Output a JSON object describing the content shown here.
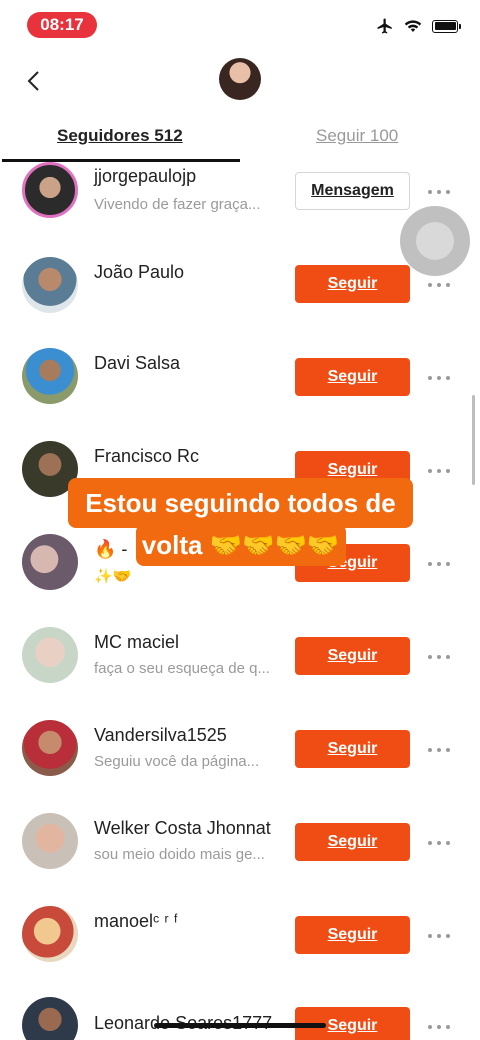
{
  "status_bar": {
    "time": "08:17",
    "airplane_icon": "airplane-icon",
    "wifi_icon": "wifi-icon",
    "battery_icon": "battery-icon"
  },
  "header": {
    "back_icon": "chevron-left-icon"
  },
  "tabs": [
    {
      "label": "Seguidores 512",
      "active": true
    },
    {
      "label": "Seguir 100",
      "active": false
    }
  ],
  "follow_label": "Seguir",
  "message_label": "Mensagem",
  "caption": {
    "line1": "Estou seguindo todos de",
    "line2": "volta 🤝🤝🤝🤝"
  },
  "users": [
    {
      "name": "jjorgepaulojp",
      "subtitle": "Vivendo de fazer graça...",
      "action": "Mensagem"
    },
    {
      "name": "João Paulo",
      "subtitle": "",
      "action": "Seguir"
    },
    {
      "name": "Davi Salsa",
      "subtitle": "",
      "action": "Seguir"
    },
    {
      "name": "Francisco Rc",
      "subtitle": "",
      "action": "Seguir"
    },
    {
      "name": "🔥 -",
      "subtitle": "✨🤝",
      "action": "Seguir"
    },
    {
      "name": "MC  maciel",
      "subtitle": "faça o seu esqueça de q...",
      "action": "Seguir"
    },
    {
      "name": "Vandersilva1525",
      "subtitle": "Seguiu você da página...",
      "action": "Seguir"
    },
    {
      "name": "Welker Costa Jhonnat",
      "subtitle": "sou meio doido mais ge...",
      "action": "Seguir"
    },
    {
      "name": "manoelᶜ ʳ ᶠ",
      "subtitle": "",
      "action": "Seguir"
    },
    {
      "name": "Leonardo Soares1777",
      "subtitle": "",
      "action": "Seguir"
    }
  ],
  "colors": {
    "accent": "#f04d14",
    "caption_bg": "#f26a10",
    "time_pill": "#e8323c"
  }
}
